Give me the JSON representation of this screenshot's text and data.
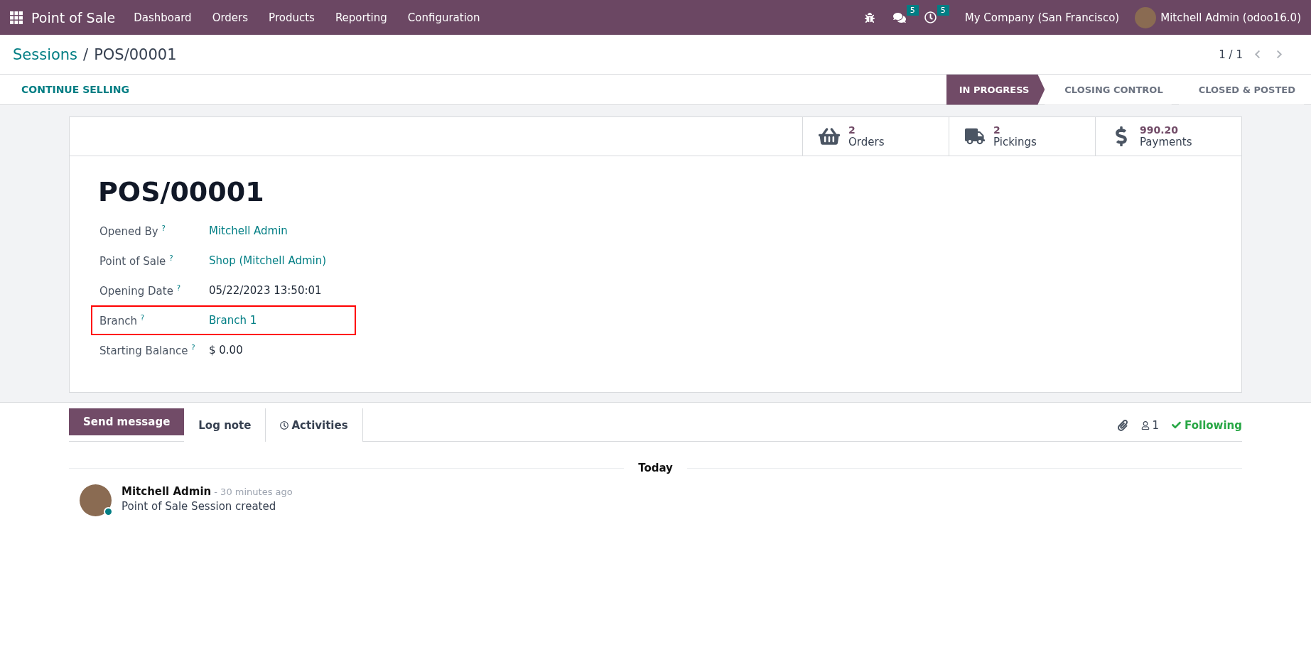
{
  "navbar": {
    "app_title": "Point of Sale",
    "menu": [
      "Dashboard",
      "Orders",
      "Products",
      "Reporting",
      "Configuration"
    ],
    "messages_count": "5",
    "activities_count": "5",
    "company": "My Company (San Francisco)",
    "user": "Mitchell Admin (odoo16.0)"
  },
  "breadcrumb": {
    "parent": "Sessions",
    "separator": "/",
    "current": "POS/00001"
  },
  "pager": "1 / 1",
  "action_button": "CONTINUE SELLING",
  "statusbar": [
    {
      "label": "IN PROGRESS",
      "selected": true
    },
    {
      "label": "CLOSING CONTROL",
      "selected": false
    },
    {
      "label": "CLOSED & POSTED",
      "selected": false
    }
  ],
  "stat_buttons": [
    {
      "kind": "basket",
      "value": "2",
      "label": "Orders"
    },
    {
      "kind": "truck",
      "value": "2",
      "label": "Pickings"
    },
    {
      "kind": "dollar",
      "value": "990.20",
      "label": "Payments"
    }
  ],
  "record_title": "POS/00001",
  "fields": [
    {
      "label": "Opened By",
      "help": "?",
      "value": "Mitchell Admin",
      "link": true,
      "highlighted": false
    },
    {
      "label": "Point of Sale",
      "help": "?",
      "value": "Shop (Mitchell Admin)",
      "link": true,
      "highlighted": false
    },
    {
      "label": "Opening Date",
      "help": "?",
      "value": "05/22/2023 13:50:01",
      "link": false,
      "highlighted": false
    },
    {
      "label": "Branch",
      "help": "?",
      "value": "Branch 1",
      "link": true,
      "highlighted": true
    },
    {
      "label": "Starting Balance",
      "help": "?",
      "value": "$ 0.00",
      "link": false,
      "highlighted": false
    }
  ],
  "chatter": {
    "tabs": [
      {
        "label": "Send message",
        "selected": true
      },
      {
        "label": "Log note",
        "selected": false
      },
      {
        "label": "Activities",
        "selected": false
      }
    ],
    "followers_count": "1",
    "follow_status": "Following",
    "date_separator": "Today",
    "messages": [
      {
        "author": "Mitchell Admin",
        "time": "- 30 minutes ago",
        "body": "Point of Sale Session created"
      }
    ]
  }
}
